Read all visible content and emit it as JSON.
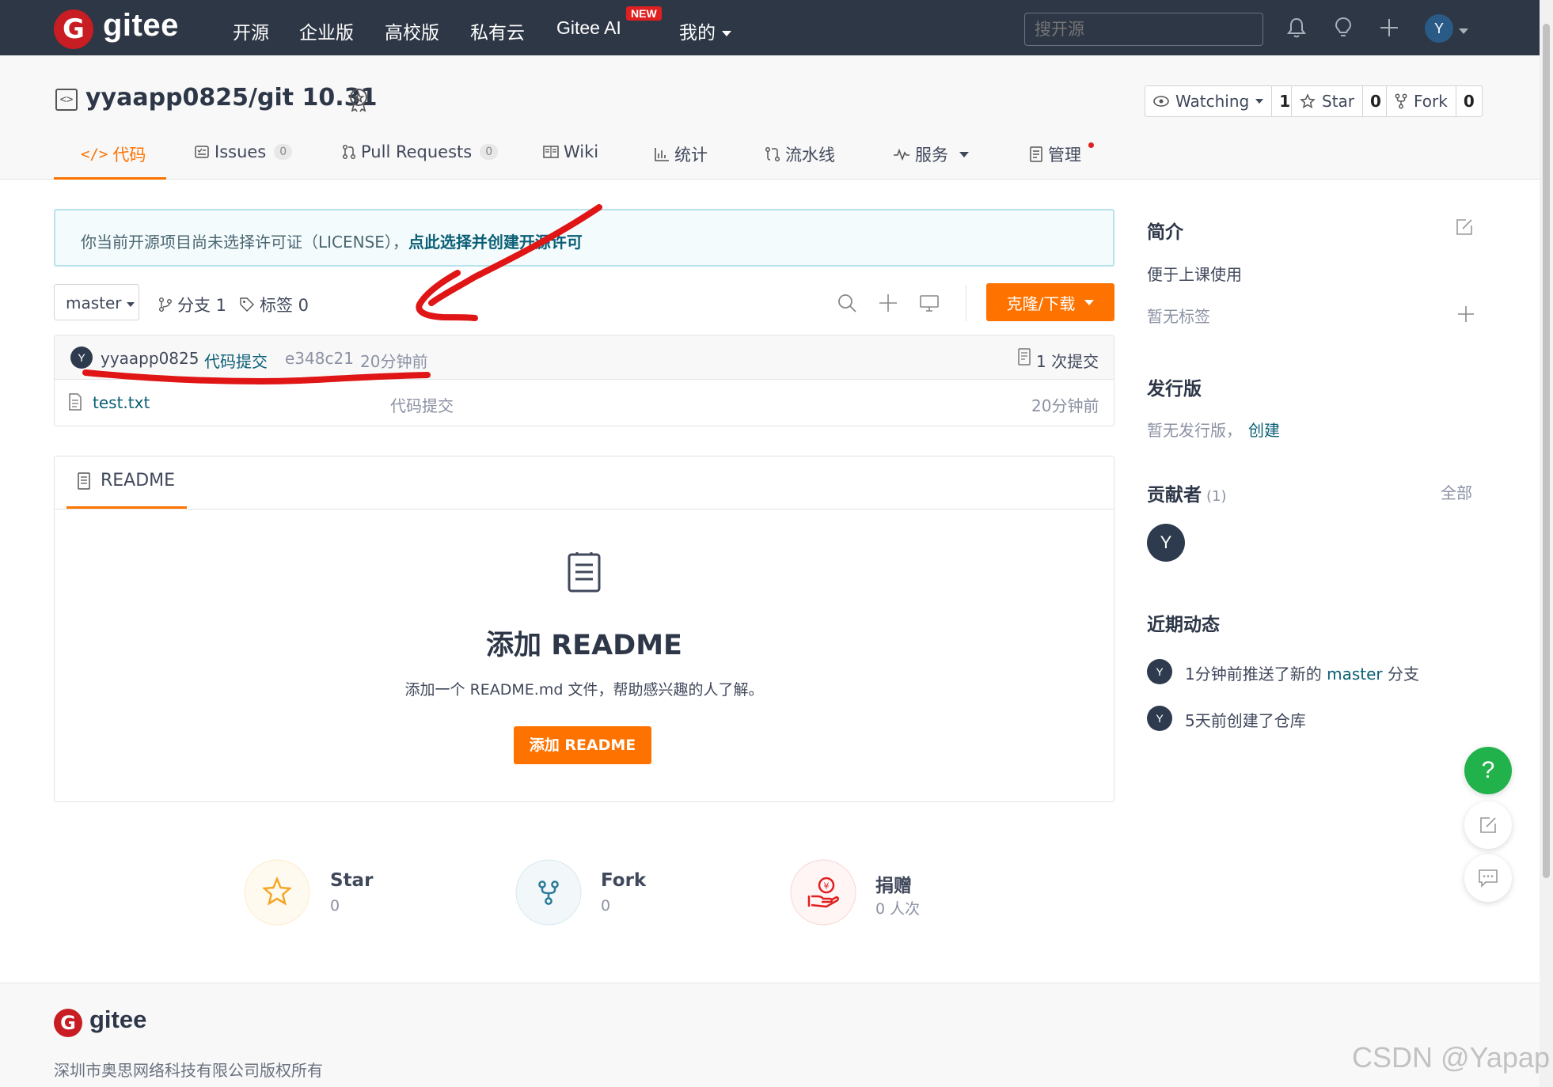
{
  "navbar": {
    "logo_letter": "G",
    "logo_text": "gitee",
    "links": [
      "开源",
      "企业版",
      "高校版",
      "私有云",
      "Gitee AI",
      "我的"
    ],
    "new_badge": "NEW",
    "search_placeholder": "搜开源",
    "avatar_letter": "Y",
    "icons": [
      "bell-icon",
      "lightbulb-icon",
      "plus-icon",
      "chevron-down-icon"
    ]
  },
  "repo": {
    "title": "yyaapp0825/git 10.31",
    "watching": {
      "label": "Watching",
      "count": "1"
    },
    "star": {
      "label": "Star",
      "count": "0"
    },
    "fork": {
      "label": "Fork",
      "count": "0"
    }
  },
  "tabs": [
    {
      "label": "代码",
      "icon": "code-icon",
      "active": true
    },
    {
      "label": "Issues",
      "count": "0",
      "icon": "issues-icon"
    },
    {
      "label": "Pull Requests",
      "count": "0",
      "icon": "pull-request-icon"
    },
    {
      "label": "Wiki",
      "icon": "book-icon"
    },
    {
      "label": "统计",
      "icon": "bar-chart-icon"
    },
    {
      "label": "流水线",
      "icon": "pipeline-icon"
    },
    {
      "label": "服务",
      "icon": "pulse-icon"
    },
    {
      "label": "管理",
      "icon": "settings-doc-icon"
    }
  ],
  "notice": {
    "text": "你当前开源项目尚未选择许可证（LICENSE），",
    "link": "点此选择并创建开源许可"
  },
  "branch_bar": {
    "branch": "master",
    "branches_label": "分支 1",
    "tags_label": "标签 0",
    "clone_label": "克隆/下载"
  },
  "commit": {
    "avatar_letter": "Y",
    "author": "yyaapp0825",
    "message": "代码提交",
    "hash": "e348c21",
    "time": "20分钟前",
    "count_label": "1 次提交"
  },
  "files": [
    {
      "name": "test.txt",
      "message": "代码提交",
      "time": "20分钟前"
    }
  ],
  "readme": {
    "tab_label": "README",
    "title": "添加 README",
    "description": "添加一个 README.md 文件，帮助感兴趣的人了解。",
    "button": "添加 README"
  },
  "stats": [
    {
      "label": "Star",
      "value": "0",
      "color": "#f5a623"
    },
    {
      "label": "Fork",
      "value": "0",
      "color": "#2a7a9a"
    },
    {
      "label": "捐赠",
      "value": "0 人次",
      "color": "#e02020"
    }
  ],
  "sidebar": {
    "intro_title": "简介",
    "intro_text": "便于上课使用",
    "no_tags": "暂无标签",
    "release_title": "发行版",
    "no_release": "暂无发行版，",
    "create_link": "创建",
    "contributors_title": "贡献者",
    "contributors_count": "(1)",
    "all_link": "全部",
    "contributor_letter": "Y",
    "activity_title": "近期动态",
    "activities": [
      {
        "letter": "Y",
        "prefix": "1分钟前推送了新的 ",
        "link": "master",
        "suffix": " 分支"
      },
      {
        "letter": "Y",
        "prefix": "5天前创建了仓库",
        "link": "",
        "suffix": ""
      }
    ]
  },
  "floating": {
    "help": "?"
  },
  "footer": {
    "logo_letter": "G",
    "logo_text": "gitee",
    "copyright": "深圳市奥思网络科技有限公司版权所有",
    "watermark": "CSDN @Yapap"
  },
  "colors": {
    "navbar_bg": "#2e3745",
    "accent": "#fe7300",
    "brand_red": "#c71d23",
    "link": "#0a5f76",
    "annotation_red": "#e01515"
  }
}
